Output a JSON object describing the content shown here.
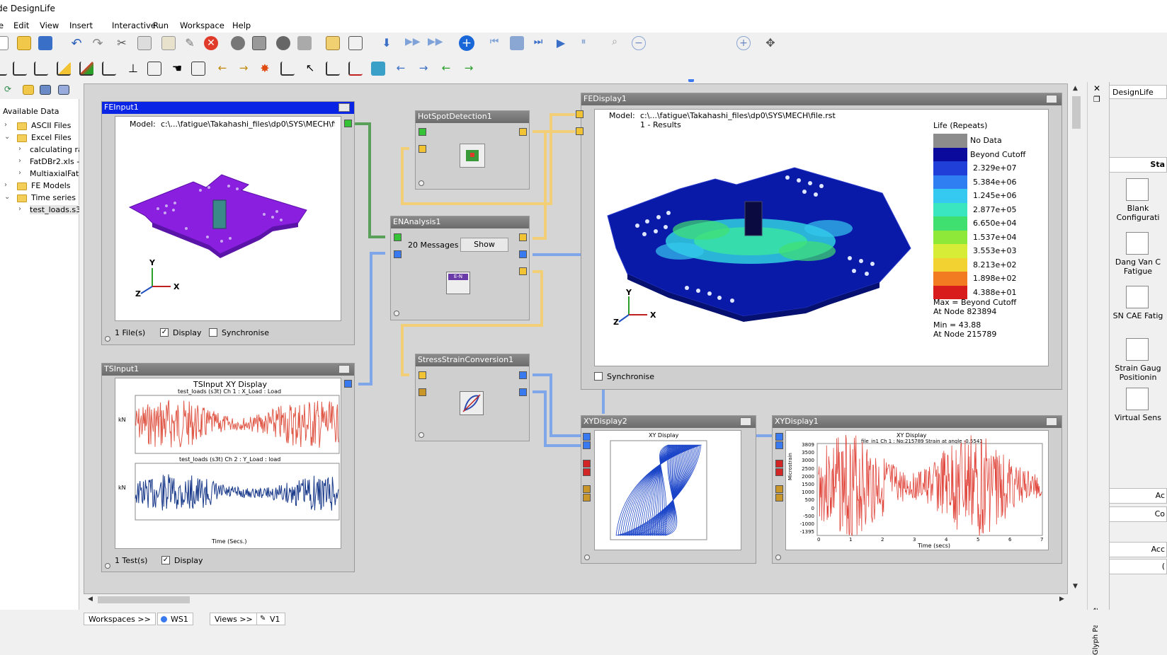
{
  "window": {
    "title": "de DesignLife"
  },
  "menu": [
    "e",
    "Edit",
    "View",
    "Insert",
    "Interactive",
    "Run",
    "Workspace",
    "Help"
  ],
  "left_panel": {
    "title": "Available Data",
    "tree": [
      {
        "label": "ASCII Files",
        "level": 0,
        "expanded": false,
        "folder": true
      },
      {
        "label": "Excel Files",
        "level": 0,
        "expanded": true,
        "folder": true
      },
      {
        "label": "calculating ra",
        "level": 1,
        "folder": false
      },
      {
        "label": "FatDBr2.xls -",
        "level": 1,
        "folder": false
      },
      {
        "label": "MultiaxialFat",
        "level": 1,
        "folder": false
      },
      {
        "label": "FE Models",
        "level": 0,
        "expanded": false,
        "folder": true
      },
      {
        "label": "Time series",
        "level": 0,
        "expanded": true,
        "folder": true
      },
      {
        "label": "test_loads.s3",
        "level": 1,
        "folder": false,
        "selected": true
      }
    ]
  },
  "feinput": {
    "title": "FEInput1",
    "model_label": "Model:",
    "model_path": "c:\\...\\fatigue\\Takahashi_files\\dp0\\SYS\\MECH\\file.rst",
    "files": "1 File(s)",
    "display_label": "Display",
    "sync_label": "Synchronise",
    "axis_y": "Y",
    "axis_x": "X",
    "axis_z": "Z"
  },
  "tsinput": {
    "title": "TSInput1",
    "plot_title": "TSInput XY Display",
    "ch1_title": "test_loads (s3t)  Ch 1 : X_Load : Load",
    "ch2_title": "test_loads (s3t)  Ch 2 : Y_Load : load",
    "xlabel": "Time (Secs.)",
    "ylabel": "kN",
    "tests": "1 Test(s)",
    "display_label": "Display"
  },
  "hotspot": {
    "title": "HotSpotDetection1"
  },
  "enanalysis": {
    "title": "ENAnalysis1",
    "messages": "20 Messages",
    "show_label": "Show",
    "icon_text": "E-N"
  },
  "stressstrain": {
    "title": "StressStrainConversion1"
  },
  "fedisplay": {
    "title": "FEDisplay1",
    "model_label": "Model:",
    "model_path": "c:\\...\\fatigue\\Takahashi_files\\dp0\\SYS\\MECH\\file.rst",
    "results": "1 - Results",
    "legend_title": "Life (Repeats)",
    "legend": [
      {
        "label": "No Data",
        "color": "#8c8c8c"
      },
      {
        "label": "Beyond Cutoff",
        "color": "#0a0a9c"
      },
      {
        "label": "2.329e+07",
        "color": "#1f3fd8"
      },
      {
        "label": "5.384e+06",
        "color": "#2f7ef2"
      },
      {
        "label": "1.245e+06",
        "color": "#35c8f0"
      },
      {
        "label": "2.877e+05",
        "color": "#3ae6c0"
      },
      {
        "label": "6.650e+04",
        "color": "#40e070"
      },
      {
        "label": "1.537e+04",
        "color": "#8ee83a"
      },
      {
        "label": "3.553e+03",
        "color": "#d6ec36"
      },
      {
        "label": "8.213e+02",
        "color": "#f2d230"
      },
      {
        "label": "1.898e+02",
        "color": "#f27a20"
      },
      {
        "label": "4.388e+01",
        "color": "#d81c1c"
      }
    ],
    "max_text": "Max = Beyond Cutoff",
    "max_node": "At Node 823894",
    "min_text": "Min = 43.88",
    "min_node": "At Node 215789",
    "sync_label": "Synchronise",
    "axis_y": "Y",
    "axis_x": "X",
    "axis_z": "Z"
  },
  "xydisplay2": {
    "title": "XYDisplay2",
    "plot_title": "XY Display"
  },
  "xydisplay1": {
    "title": "XYDisplay1",
    "plot_title": "XY Display",
    "subtitle": "file_in1  Ch 1 : No:215789 Strain at angle -0.5541",
    "xlabel": "Time (secs)",
    "ylabel": "Microstrain",
    "yticks": [
      "3809",
      "3500",
      "3000",
      "2500",
      "2000",
      "1500",
      "1000",
      "500",
      "0",
      "-500",
      "-1000",
      "-1395"
    ],
    "xticks": [
      "0",
      "1",
      "2",
      "3",
      "4",
      "5",
      "6",
      "7"
    ]
  },
  "palette": {
    "title": "DesignLife",
    "section": "Sta",
    "strip_label": "Glyph Palette",
    "items": [
      {
        "label": "Blank Configurati",
        "icon": "question-icon"
      },
      {
        "label": "Dang Van C Fatigue",
        "icon": "sfe-icon"
      },
      {
        "label": "SN CAE Fatig",
        "icon": "sn-icon"
      },
      {
        "label": "Strain Gaug Positionin",
        "icon": "strain-icon"
      },
      {
        "label": "Virtual Sens",
        "icon": "sensor-icon"
      }
    ],
    "buttons": [
      "Ac",
      "Co",
      "Acc",
      "("
    ]
  },
  "bottom_tabs": [
    "Workspaces >>",
    "WS1",
    "Views >>",
    "V1"
  ],
  "colors": {
    "accent": "#0a24e6",
    "ports_green": "#36c236",
    "ports_yellow": "#f2c332",
    "ports_blue": "#3a7af0"
  }
}
